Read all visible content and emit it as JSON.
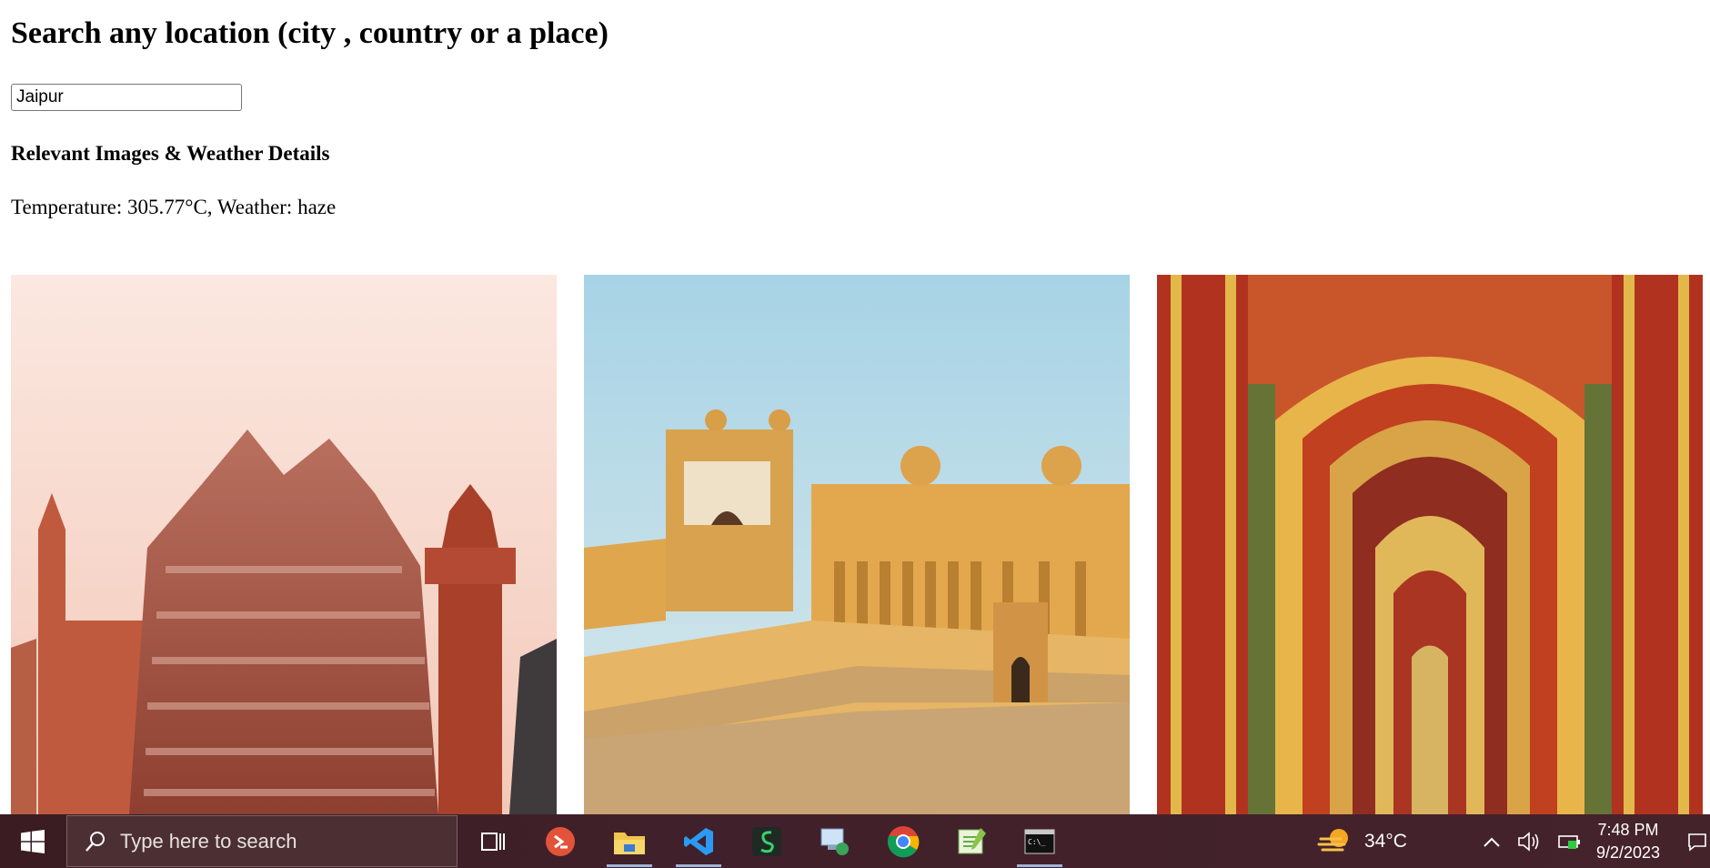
{
  "page": {
    "title": "Search any location (city , country or a place)",
    "search": {
      "value": "Jaipur"
    },
    "section_heading": "Relevant Images & Weather Details",
    "weather_text": "Temperature: 305.77°C, Weather: haze"
  },
  "gallery": {
    "images": [
      {
        "subject": "hawa-mahal"
      },
      {
        "subject": "amber-fort"
      },
      {
        "subject": "ornate-gateway"
      }
    ]
  },
  "taskbar": {
    "search_placeholder": "Type here to search",
    "weather_temp": "34°C",
    "time": "7:48 PM",
    "date": "9/2/2023",
    "apps": [
      "task-view",
      "remote-desktop",
      "file-explorer",
      "vscode",
      "sheets-app",
      "network-app",
      "chrome",
      "notepad-plus",
      "terminal"
    ]
  },
  "colors": {
    "taskbar_bg": "#40202a",
    "taskbar_accent": "#9fb4d8"
  }
}
